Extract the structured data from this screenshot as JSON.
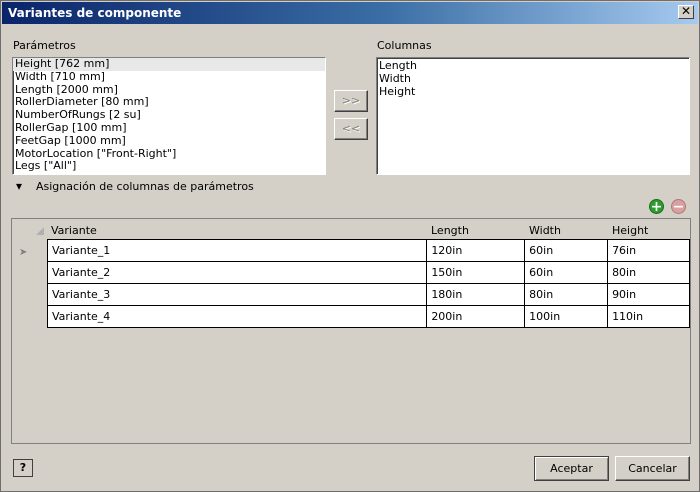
{
  "window": {
    "title": "Variantes de componente",
    "close_glyph": "✕"
  },
  "parameters": {
    "label": "Parámetros",
    "items": [
      "Height [762 mm]",
      "Width [710 mm]",
      "Length [2000 mm]",
      "RollerDiameter [80 mm]",
      "NumberOfRungs [2 su]",
      "RollerGap [100 mm]",
      "FeetGap [1000 mm]",
      "MotorLocation [\"Front-Right\"]",
      "Legs [\"All\"]"
    ]
  },
  "transfer": {
    "add_label": ">>",
    "remove_label": "<<"
  },
  "columns": {
    "label": "Columnas",
    "items": [
      "Length",
      "Width",
      "Height"
    ]
  },
  "mapping": {
    "label": "Asignación de columnas de parámetros",
    "expander_glyph": "▾"
  },
  "grid_actions": {
    "add_glyph": "+",
    "remove_glyph": "−"
  },
  "grid": {
    "headers": [
      "Variante",
      "Length",
      "Width",
      "Height"
    ],
    "rows": [
      [
        "Variante_1",
        "120in",
        "60in",
        "76in"
      ],
      [
        "Variante_2",
        "150in",
        "60in",
        "80in"
      ],
      [
        "Variante_3",
        "180in",
        "80in",
        "90in"
      ],
      [
        "Variante_4",
        "200in",
        "100in",
        "110in"
      ]
    ],
    "current_row_marker": "➤"
  },
  "footer": {
    "help_label": "?",
    "accept_label": "Aceptar",
    "cancel_label": "Cancelar"
  },
  "colors": {
    "title_start": "#0a246a",
    "title_end": "#a6caf0",
    "add": "#2e9b2e",
    "remove": "#d8a0a0"
  }
}
